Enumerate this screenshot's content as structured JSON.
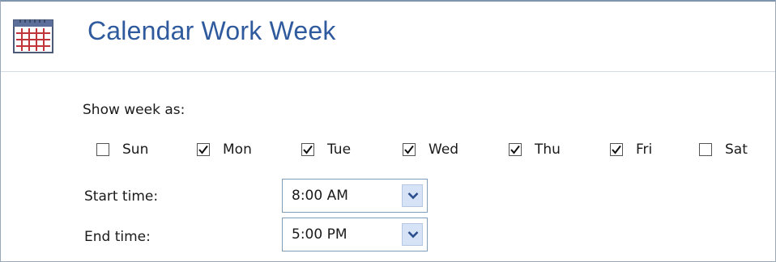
{
  "header": {
    "title": "Calendar Work Week",
    "icon": "calendar-icon"
  },
  "week": {
    "label": "Show week as:",
    "days": [
      {
        "label": "Sun",
        "checked": false
      },
      {
        "label": "Mon",
        "checked": true
      },
      {
        "label": "Tue",
        "checked": true
      },
      {
        "label": "Wed",
        "checked": true
      },
      {
        "label": "Thu",
        "checked": true
      },
      {
        "label": "Fri",
        "checked": true
      },
      {
        "label": "Sat",
        "checked": false
      }
    ]
  },
  "start_time": {
    "label": "Start time:",
    "value": "8:00 AM"
  },
  "end_time": {
    "label": "End time:",
    "value": "5:00 PM"
  },
  "colors": {
    "title": "#2f5b9e",
    "dropdown_arrow_bg": "#d6e2f5",
    "border": "#7f9db9"
  }
}
